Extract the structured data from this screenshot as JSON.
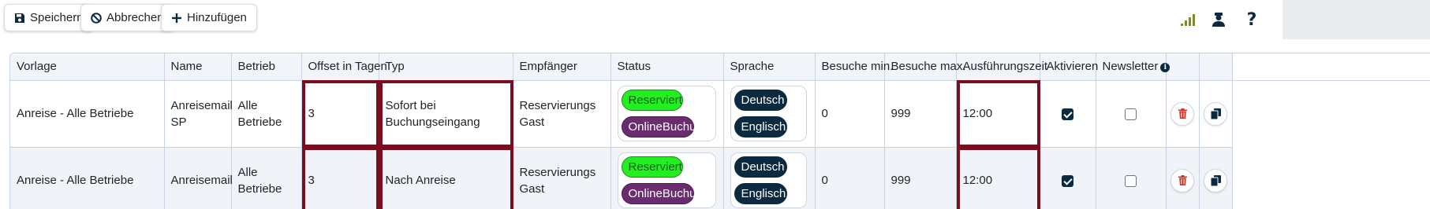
{
  "toolbar": {
    "save_label": "Speichern",
    "cancel_label": "Abbrechen",
    "add_label": "Hinzufügen",
    "signal_color": "#7d8a2e"
  },
  "table": {
    "headers": {
      "vorlage": "Vorlage",
      "name": "Name",
      "betrieb": "Betrieb",
      "offset": "Offset in Tagen",
      "typ": "Typ",
      "empfaenger": "Empfänger",
      "status": "Status",
      "sprache": "Sprache",
      "besuche_min": "Besuche min.",
      "besuche_max": "Besuche max.",
      "ausfuehrungszeit": "Ausführungszeit",
      "aktivieren": "Aktivieren",
      "newsletter": "Newsletter"
    },
    "rows": [
      {
        "vorlage": "Anreise - Alle Betriebe",
        "name": "Anreisemail SP",
        "betrieb": "Alle Betriebe",
        "offset": "3",
        "typ": "Sofort bei Buchungseingang",
        "empfaenger": "Reservierungs Gast",
        "status": [
          "Reserviert",
          "OnlineBuchung"
        ],
        "sprache": [
          "Deutsch",
          "Englisch"
        ],
        "besuche_min": "0",
        "besuche_max": "999",
        "ausfuehrungszeit": "12:00",
        "aktivieren": true,
        "newsletter": false
      },
      {
        "vorlage": "Anreise - Alle Betriebe",
        "name": "Anreisemail",
        "betrieb": "Alle Betriebe",
        "offset": "3",
        "typ": "Nach Anreise",
        "empfaenger": "Reservierungs Gast",
        "status": [
          "Reserviert",
          "OnlineBuchung"
        ],
        "sprache": [
          "Deutsch",
          "Englisch"
        ],
        "besuche_min": "0",
        "besuche_max": "999",
        "ausfuehrungszeit": "12:00",
        "aktivieren": true,
        "newsletter": false
      }
    ]
  },
  "colors": {
    "highlight": "#7a0d20",
    "reserviert_bg": "#22ee22",
    "online_bg": "#6a2c6e",
    "lang_bg": "#0b2a3f",
    "delete_icon": "#c0392b"
  },
  "icons": {
    "save": "save-icon",
    "cancel": "ban-icon",
    "add": "plus-icon",
    "signal": "signal-icon",
    "user": "user-icon",
    "help": "question-icon",
    "delete": "trash-icon",
    "copy": "copy-icon",
    "info": "info-icon"
  }
}
